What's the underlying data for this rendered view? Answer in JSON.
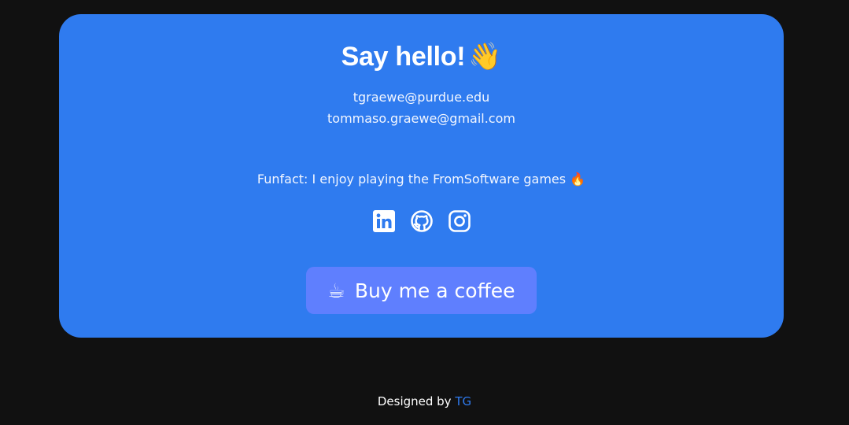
{
  "contact": {
    "title": "Say hello!",
    "title_emoji": "👋",
    "emails": [
      "tgraewe@purdue.edu",
      "tommaso.graewe@gmail.com"
    ],
    "funfact": "Funfact: I enjoy playing the FromSoftware games",
    "funfact_emoji": "🔥",
    "socials": [
      {
        "name": "LinkedIn",
        "icon": "linkedin-icon"
      },
      {
        "name": "GitHub",
        "icon": "github-icon"
      },
      {
        "name": "Instagram",
        "icon": "instagram-icon"
      }
    ],
    "coffee_button": {
      "emoji": "☕",
      "label": "Buy me a coffee"
    }
  },
  "footer": {
    "prefix": "Designed by",
    "link_label": "TG"
  },
  "colors": {
    "page_background": "#111111",
    "card_background": "#2f7bef",
    "button_background": "#5f7ffe",
    "link": "#2f7bef",
    "text": "#ffffff"
  }
}
